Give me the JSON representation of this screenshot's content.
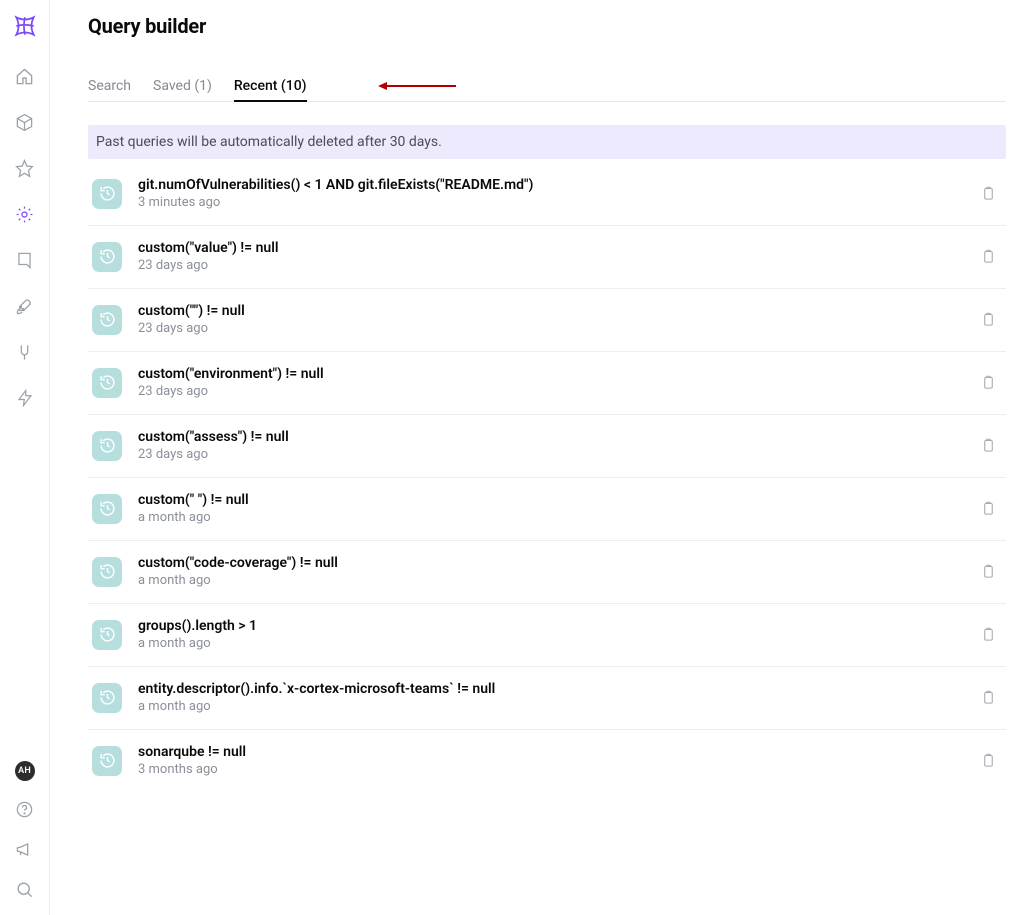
{
  "page": {
    "title": "Query builder"
  },
  "tabs": {
    "search": "Search",
    "saved": "Saved (1)",
    "recent": "Recent (10)"
  },
  "banner": "Past queries will be automatically deleted after 30 days.",
  "avatar": "AH",
  "queries": [
    {
      "title": "git.numOfVulnerabilities() < 1 AND git.fileExists(\"README.md\")",
      "time": "3 minutes ago"
    },
    {
      "title": "custom(\"value\") != null",
      "time": "23 days ago"
    },
    {
      "title": "custom(\"\") != null",
      "time": "23 days ago"
    },
    {
      "title": "custom(\"environment\") != null",
      "time": "23 days ago"
    },
    {
      "title": "custom(\"assess\") != null",
      "time": "23 days ago"
    },
    {
      "title": "custom(\" \") != null",
      "time": "a month ago"
    },
    {
      "title": "custom(\"code-coverage\") != null",
      "time": "a month ago"
    },
    {
      "title": "groups().length > 1",
      "time": "a month ago"
    },
    {
      "title": "entity.descriptor().info.`x-cortex-microsoft-teams` != null",
      "time": "a month ago"
    },
    {
      "title": "sonarqube != null",
      "time": "3 months ago"
    }
  ]
}
